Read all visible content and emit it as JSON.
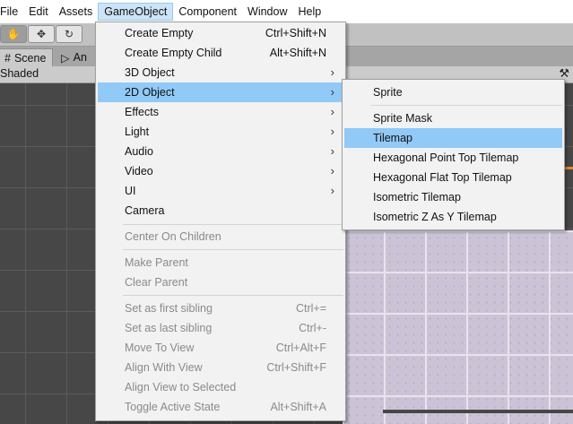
{
  "menubar": [
    "File",
    "Edit",
    "Assets",
    "GameObject",
    "Component",
    "Window",
    "Help"
  ],
  "toolbar": {
    "hand": "✋",
    "move": "✥",
    "rotate": "↻"
  },
  "tabs": {
    "scene": "Scene",
    "scene_icon": "#",
    "animation": "An",
    "animation_icon": "▷"
  },
  "scenebar": {
    "shaded": "Shaded",
    "tools_icon": "⚒"
  },
  "gameobject_menu": {
    "create_empty": {
      "label": "Create Empty",
      "shortcut": "Ctrl+Shift+N"
    },
    "create_empty_child": {
      "label": "Create Empty Child",
      "shortcut": "Alt+Shift+N"
    },
    "object_3d": {
      "label": "3D Object"
    },
    "object_2d": {
      "label": "2D Object"
    },
    "effects": {
      "label": "Effects"
    },
    "light": {
      "label": "Light"
    },
    "audio": {
      "label": "Audio"
    },
    "video": {
      "label": "Video"
    },
    "ui": {
      "label": "UI"
    },
    "camera": {
      "label": "Camera"
    },
    "center_on_children": {
      "label": "Center On Children"
    },
    "make_parent": {
      "label": "Make Parent"
    },
    "clear_parent": {
      "label": "Clear Parent"
    },
    "set_first_sibling": {
      "label": "Set as first sibling",
      "shortcut": "Ctrl+="
    },
    "set_last_sibling": {
      "label": "Set as last sibling",
      "shortcut": "Ctrl+-"
    },
    "move_to_view": {
      "label": "Move To View",
      "shortcut": "Ctrl+Alt+F"
    },
    "align_with_view": {
      "label": "Align With View",
      "shortcut": "Ctrl+Shift+F"
    },
    "align_view_to_selected": {
      "label": "Align View to Selected"
    },
    "toggle_active_state": {
      "label": "Toggle Active State",
      "shortcut": "Alt+Shift+A"
    },
    "submenu_arrow": "›"
  },
  "submenu_2d": {
    "sprite": "Sprite",
    "sprite_mask": "Sprite Mask",
    "tilemap": "Tilemap",
    "hex_point_top": "Hexagonal Point Top Tilemap",
    "hex_flat_top": "Hexagonal Flat Top Tilemap",
    "isometric": "Isometric Tilemap",
    "isometric_z_as_y": "Isometric Z As Y Tilemap"
  },
  "colors": {
    "highlight": "#91c9f7",
    "menubar_active": "#cce4f7"
  }
}
